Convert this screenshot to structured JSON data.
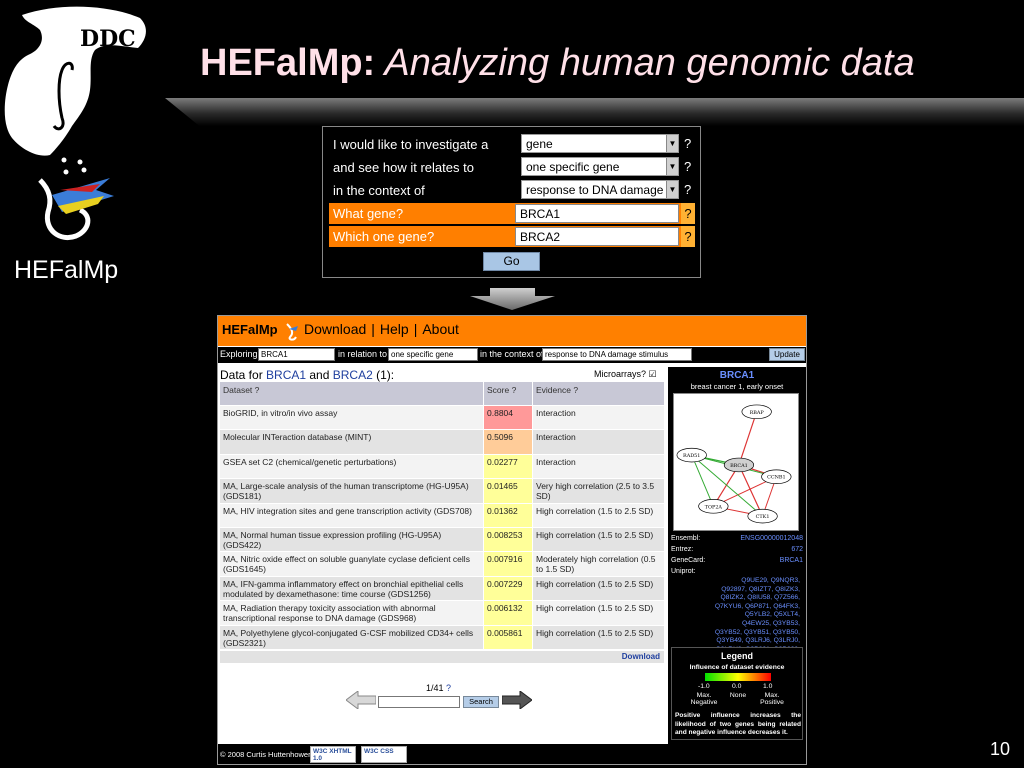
{
  "slide": {
    "title_bold": "HEFalMp:",
    "title_rest": " Analyzing human genomic data",
    "logo_label": "HEFalMp",
    "page_number": "10"
  },
  "query_form": {
    "rows": [
      {
        "label": "I would like to investigate a",
        "value": "gene",
        "help": "?"
      },
      {
        "label": "and see how it relates to",
        "value": "one specific gene",
        "help": "?"
      },
      {
        "label": "in the context of",
        "value": "response to DNA damage",
        "help": "?"
      }
    ],
    "inputs": [
      {
        "label": "What gene?",
        "value": "BRCA1",
        "help": "?"
      },
      {
        "label": "Which one gene?",
        "value": "BRCA2",
        "help": "?"
      }
    ],
    "go_label": "Go"
  },
  "app": {
    "brand": "HEFalMp",
    "nav": [
      "Download",
      "Help",
      "About"
    ],
    "search_bar": {
      "exploring_label": "Exploring",
      "exploring_value": "BRCA1",
      "relation_label": "in relation to",
      "relation_value": "one specific gene",
      "context_label": "in the context of",
      "context_value": "response to DNA damage stimulus",
      "update_label": "Update"
    },
    "data_header": {
      "prefix": "Data for ",
      "gene1": "BRCA1",
      "and": " and ",
      "gene2": "BRCA2",
      "count": " (1):"
    },
    "microarrays_label": "Microarrays?",
    "microarrays_checked": "☑",
    "table": {
      "headers": [
        "Dataset ?",
        "Score ?",
        "Evidence ?"
      ],
      "rows": [
        {
          "dataset": "BioGRID, in vitro/in vivo assay",
          "score": "0.8804",
          "evidence": "Interaction",
          "color": "#ff9999"
        },
        {
          "dataset": "Molecular INTeraction database (MINT)",
          "score": "0.5096",
          "evidence": "Interaction",
          "color": "#ffcc99"
        },
        {
          "dataset": "GSEA set C2 (chemical/genetic perturbations)",
          "score": "0.02277",
          "evidence": "Interaction",
          "color": "#ffff99"
        },
        {
          "dataset": "MA, Large-scale analysis of the human transcriptome (HG-U95A) (GDS181)",
          "score": "0.01465",
          "evidence": "Very high correlation (2.5 to 3.5 SD)",
          "color": "#ffff99"
        },
        {
          "dataset": "MA, HIV integration sites and gene transcription activity (GDS708)",
          "score": "0.01362",
          "evidence": "High correlation (1.5 to 2.5 SD)",
          "color": "#ffff99"
        },
        {
          "dataset": "MA, Normal human tissue expression profiling (HG-U95A) (GDS422)",
          "score": "0.008253",
          "evidence": "High correlation (1.5 to 2.5 SD)",
          "color": "#ffff99"
        },
        {
          "dataset": "MA, Nitric oxide effect on soluble guanylate cyclase deficient cells (GDS1645)",
          "score": "0.007916",
          "evidence": "Moderately high correlation (0.5 to 1.5 SD)",
          "color": "#ffff99"
        },
        {
          "dataset": "MA, IFN-gamma inflammatory effect on bronchial epithelial cells modulated by dexamethasone: time course (GDS1256)",
          "score": "0.007229",
          "evidence": "High correlation (1.5 to 2.5 SD)",
          "color": "#ffff99"
        },
        {
          "dataset": "MA, Radiation therapy toxicity association with abnormal transcriptional response to DNA damage (GDS968)",
          "score": "0.006132",
          "evidence": "High correlation (1.5 to 2.5 SD)",
          "color": "#ffff99"
        },
        {
          "dataset": "MA, Polyethylene glycol-conjugated G-CSF mobilized CD34+ cells (GDS2321)",
          "score": "0.005861",
          "evidence": "High correlation (1.5 to 2.5 SD)",
          "color": "#ffff99"
        }
      ],
      "download_label": "Download"
    },
    "pager": {
      "count": "1/41",
      "help": "?",
      "search_label": "Search"
    },
    "footer": {
      "copyright": "© 2008 Curtis Huttenhower",
      "badge1": "W3C XHTML 1.0",
      "badge2": "W3C CSS"
    },
    "side": {
      "gene": "BRCA1",
      "description": "breast cancer 1, early onset",
      "network_nodes": [
        "RBAP",
        "RAD51",
        "BRCA1",
        "CCNB1",
        "TOP2A",
        "CTK1"
      ],
      "ensembl_label": "Ensembl:",
      "ensembl_value": "ENSG00000012048",
      "entrez_label": "Entrez:",
      "entrez_value": "672",
      "genecard_label": "GeneCard:",
      "genecard_value": "BRCA1",
      "uniprot_label": "Uniprot:",
      "uniprot_value": "Q9UE29, Q9NQR3, Q92897, Q8IZT7, Q8IZK3, Q8IZK2, Q8IU58, Q7Z566, Q7KYU6, Q6P871, Q64FK3, Q5YLB2, Q5XLT4, Q4EW25, Q3YB53, Q3YB52, Q3YB51, Q3YB50, Q3YB49, Q3LRJ6, Q3LRJ0, Q3LRH8, Q3B891, Q3B890, Q1RMC1, Q05BZ9, P38398, O15129",
      "legend": {
        "title": "Legend",
        "subtitle": "Influence of dataset evidence",
        "ticks": [
          "-1.0",
          "0.0",
          "1.0"
        ],
        "words": [
          "Max. Negative",
          "None",
          "Max. Positive"
        ],
        "description": "Positive influence increases the likelihood of two genes being related and negative influence decreases it."
      }
    }
  },
  "colors": {
    "orange": "#ff8000",
    "accent_blue": "#6a8fff",
    "score_red": "#ff9999",
    "score_yellow": "#ffff99"
  }
}
